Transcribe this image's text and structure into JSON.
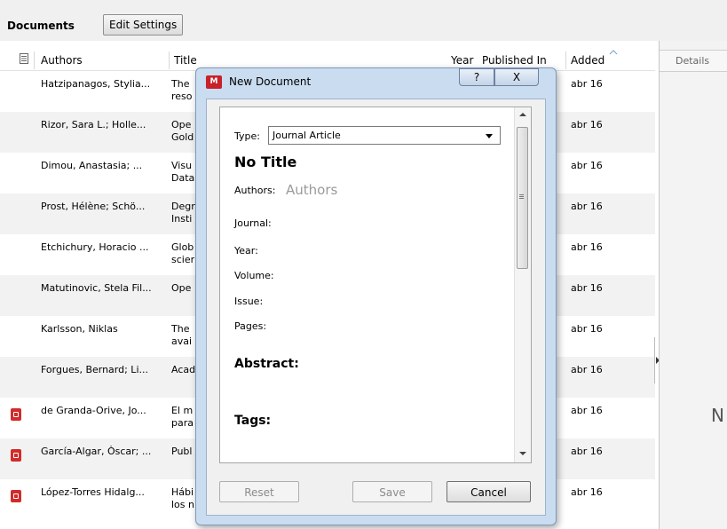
{
  "toolbar": {
    "documents_label": "Documents",
    "edit_settings_label": "Edit Settings"
  },
  "columns": {
    "icon": "",
    "authors": "Authors",
    "title": "Title",
    "year": "Year",
    "published_in": "Published In",
    "added": "Added"
  },
  "rows": [
    {
      "authors": "Hatzipanagos, Stylia...",
      "title": "The",
      "title2": "reso",
      "added": "abr 16",
      "pdf": false
    },
    {
      "authors": "Rizor, Sara L.; Holle...",
      "title": "Ope",
      "title2": "Gold",
      "added": "abr 16",
      "pdf": false
    },
    {
      "authors": "Dimou, Anastasia; ...",
      "title": "Visu",
      "title2": "Data",
      "added": "abr 16",
      "pdf": false
    },
    {
      "authors": "Prost, Hélène; Schö...",
      "title": "Degr",
      "title2": "Insti",
      "added": "abr 16",
      "pdf": false
    },
    {
      "authors": "Etchichury, Horacio ...",
      "title": "Glob",
      "title2": "scier",
      "added": "abr 16",
      "pdf": false
    },
    {
      "authors": "Matutinovic, Stela Fil...",
      "title": "Ope",
      "title2": "",
      "added": "abr 16",
      "pdf": false
    },
    {
      "authors": "Karlsson, Niklas",
      "title": "The",
      "title2": "avai",
      "added": "abr 16",
      "pdf": false
    },
    {
      "authors": "Forgues, Bernard; Li...",
      "title": "Acad",
      "title2": "",
      "added": "abr 16",
      "pdf": false
    },
    {
      "authors": "de Granda-Orive, Jo...",
      "title": "El m",
      "title2": "para",
      "added": "abr 16",
      "pdf": true
    },
    {
      "authors": "García-Algar, Òscar; ...",
      "title": "Publ",
      "title2": "",
      "added": "abr 16",
      "pdf": true
    },
    {
      "authors": "López-Torres Hidalg...",
      "title": "Hábi",
      "title2": "los n",
      "added": "abr 16",
      "pdf": true
    }
  ],
  "details": {
    "tab_label": "Details",
    "placeholder_char": "N"
  },
  "dialog": {
    "title": "New Document",
    "logo_text": "M",
    "help_glyph": "?",
    "close_glyph": "X",
    "type_label": "Type:",
    "type_value": "Journal Article",
    "doc_title": "No Title",
    "authors_label": "Authors:",
    "authors_placeholder": "Authors",
    "fields": [
      "Journal:",
      "Year:",
      "Volume:",
      "Issue:",
      "Pages:"
    ],
    "abstract_label": "Abstract:",
    "tags_label": "Tags:",
    "reset_label": "Reset",
    "save_label": "Save",
    "cancel_label": "Cancel"
  },
  "colors": {
    "accent_blue": "#c9dcf0",
    "pdf_red": "#d12b2b",
    "logo_red": "#c8212a"
  }
}
